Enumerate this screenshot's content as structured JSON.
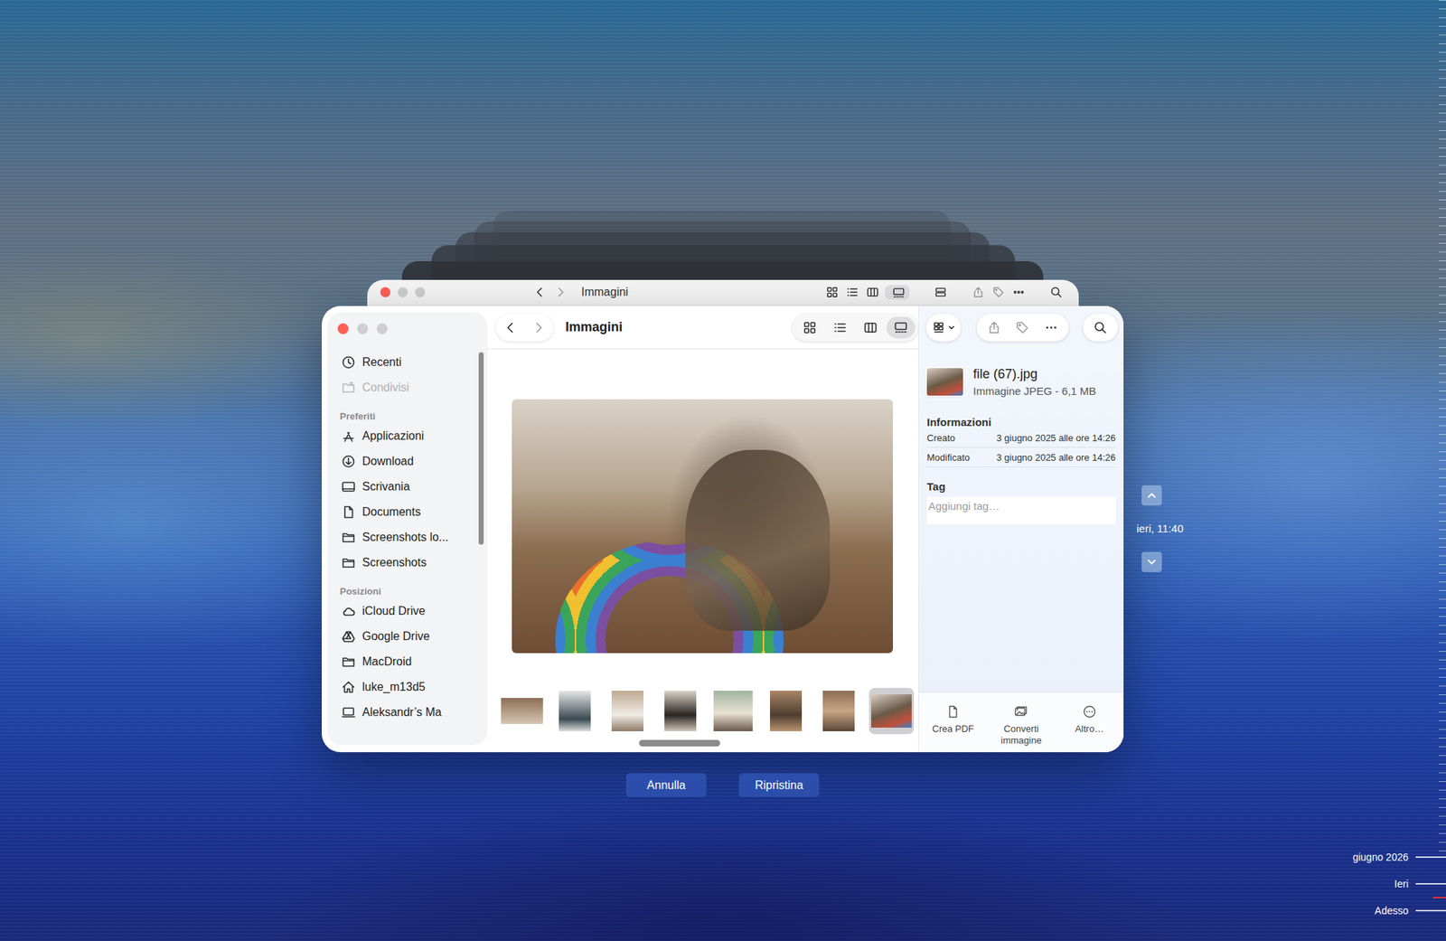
{
  "back_window": {
    "title": "Immagini"
  },
  "finder_window": {
    "title": "Immagini",
    "views": [
      {
        "kind": "icons",
        "selected": false
      },
      {
        "kind": "list",
        "selected": false
      },
      {
        "kind": "columns",
        "selected": false
      },
      {
        "kind": "gallery",
        "selected": true
      }
    ],
    "sidebar": {
      "sections": [
        {
          "items": [
            {
              "label": "Recenti",
              "kind": "clock",
              "disabled": false,
              "selected": false
            },
            {
              "label": "Condivisi",
              "kind": "shared",
              "disabled": true,
              "selected": false
            }
          ]
        },
        {
          "header": "Preferiti",
          "items": [
            {
              "label": "Applicazioni",
              "kind": "apps",
              "disabled": false,
              "selected": false
            },
            {
              "label": "Download",
              "kind": "download",
              "disabled": false,
              "selected": false
            },
            {
              "label": "Scrivania",
              "kind": "desktop",
              "disabled": false,
              "selected": false
            },
            {
              "label": "Documents",
              "kind": "document",
              "disabled": false,
              "selected": false
            },
            {
              "label": "Screenshots lo...",
              "kind": "folder",
              "disabled": false,
              "selected": false
            },
            {
              "label": "Screenshots",
              "kind": "folder",
              "disabled": false,
              "selected": false
            }
          ]
        },
        {
          "header": "Posizioni",
          "items": [
            {
              "label": "iCloud Drive",
              "kind": "cloud",
              "disabled": false,
              "selected": false
            },
            {
              "label": "Google Drive",
              "kind": "drive",
              "disabled": false,
              "selected": false
            },
            {
              "label": "MacDroid",
              "kind": "folder",
              "disabled": false,
              "selected": false
            },
            {
              "label": "luke_m13d5",
              "kind": "home",
              "disabled": false,
              "selected": false
            },
            {
              "label": "Aleksandr’s Ma",
              "kind": "computer",
              "disabled": false,
              "selected": false
            }
          ]
        }
      ]
    },
    "thumbnails": [
      {
        "selected": false
      },
      {
        "selected": false
      },
      {
        "selected": false
      },
      {
        "selected": false
      },
      {
        "selected": false
      },
      {
        "selected": false
      },
      {
        "selected": false
      },
      {
        "selected": false
      },
      {
        "selected": true
      }
    ],
    "inspector": {
      "file_name": "file (67).jpg",
      "file_kind": "Immagine JPEG - 6,1 MB",
      "section": "Informazioni",
      "rows": [
        {
          "label": "Creato",
          "value": "3 giugno 2025 alle ore 14:26"
        },
        {
          "label": "Modificato",
          "value": "3 giugno 2025 alle ore 14:26"
        }
      ],
      "tag_label": "Tag",
      "tag_placeholder": "Aggiungi tag…",
      "actions": [
        {
          "label": "Crea PDF",
          "kind": "pdf"
        },
        {
          "label": "Converti immagine",
          "kind": "convert"
        },
        {
          "label": "Altro…",
          "kind": "more"
        }
      ]
    }
  },
  "buttons": [
    {
      "label": "Annulla"
    },
    {
      "label": "Ripristina"
    }
  ],
  "timeline": {
    "current": "ieri, 11:40",
    "marks": [
      {
        "label": "giugno 2026"
      },
      {
        "label": "Ieri"
      },
      {
        "label": "Adesso"
      }
    ]
  }
}
